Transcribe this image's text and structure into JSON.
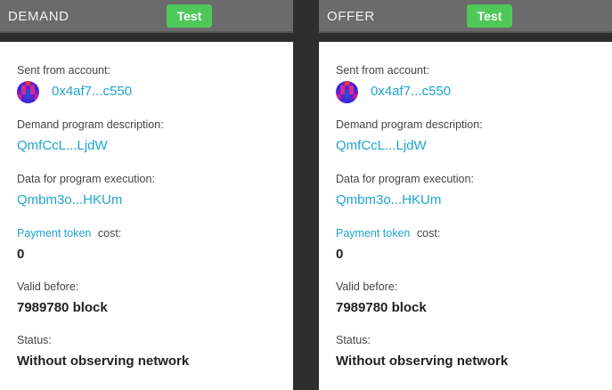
{
  "demand": {
    "title": "DEMAND",
    "test_label": "Test",
    "sent_from_label": "Sent from account:",
    "account": "0x4af7...c550",
    "description_label": "Demand program description:",
    "description_link": "QmfCcL...LjdW",
    "data_label": "Data for program execution:",
    "data_link": "Qmbm3o...HKUm",
    "payment_token_link": "Payment token",
    "cost_label": "cost:",
    "cost_value": "0",
    "valid_before_label": "Valid before:",
    "valid_before_value": "7989780 block",
    "status_label": "Status:",
    "status_value": "Without observing network"
  },
  "offer": {
    "title": "OFFER",
    "test_label": "Test",
    "sent_from_label": "Sent from account:",
    "account": "0x4af7...c550",
    "description_label": "Demand program description:",
    "description_link": "QmfCcL...LjdW",
    "data_label": "Data for program execution:",
    "data_link": "Qmbm3o...HKUm",
    "payment_token_link": "Payment token",
    "cost_label": "cost:",
    "cost_value": "0",
    "valid_before_label": "Valid before:",
    "valid_before_value": "7989780 block",
    "status_label": "Status:",
    "status_value": "Without observing network"
  },
  "colors": {
    "background": "#2e2e2e",
    "header": "#6b6b6b",
    "test_button": "#4fc85a",
    "link": "#1fa4cf"
  },
  "icons": {
    "account_avatar": "identicon-icon"
  }
}
